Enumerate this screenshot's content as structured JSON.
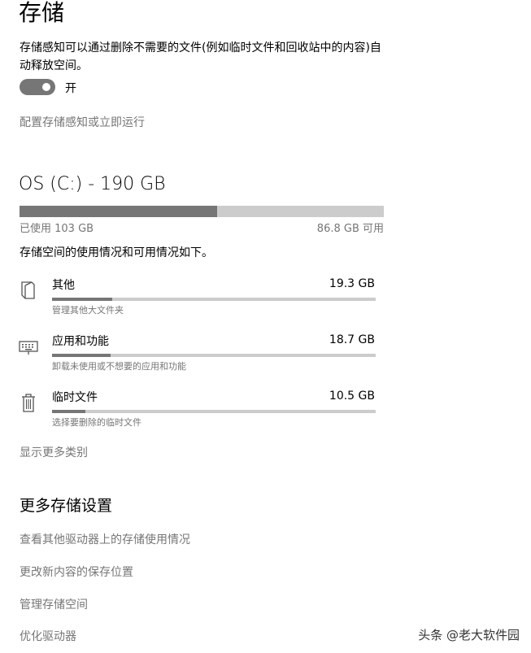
{
  "header": {
    "title": "存储"
  },
  "storage_sense": {
    "description": "存储感知可以通过删除不需要的文件(例如临时文件和回收站中的内容)自动释放空间。",
    "toggle_state": "开",
    "toggle_on": true,
    "configure_link": "配置存储感知或立即运行"
  },
  "drive": {
    "title": "OS (C:) - 190 GB",
    "used_label": "已使用 103 GB",
    "free_label": "86.8 GB 可用",
    "used_fraction": 0.542
  },
  "usage": {
    "description": "存储空间的使用情况和可用情况如下。",
    "categories": [
      {
        "label": "其他",
        "size": "19.3 GB",
        "subtitle": "管理其他大文件夹",
        "icon": "folder-icon",
        "fraction": 0.186
      },
      {
        "label": "应用和功能",
        "size": "18.7 GB",
        "subtitle": "卸载未使用或不想要的应用和功能",
        "icon": "keyboard-icon",
        "fraction": 0.181
      },
      {
        "label": "临时文件",
        "size": "10.5 GB",
        "subtitle": "选择要删除的临时文件",
        "icon": "trash-icon",
        "fraction": 0.102
      }
    ],
    "show_more": "显示更多类别"
  },
  "more_settings": {
    "title": "更多存储设置",
    "links": [
      "查看其他驱动器上的存储使用情况",
      "更改新内容的保存位置",
      "管理存储空间",
      "优化驱动器"
    ]
  },
  "watermark": "头条 @老大软件园",
  "colors": {
    "accent_gray": "#767676",
    "track": "#cccccc",
    "background": "#ffffff"
  }
}
